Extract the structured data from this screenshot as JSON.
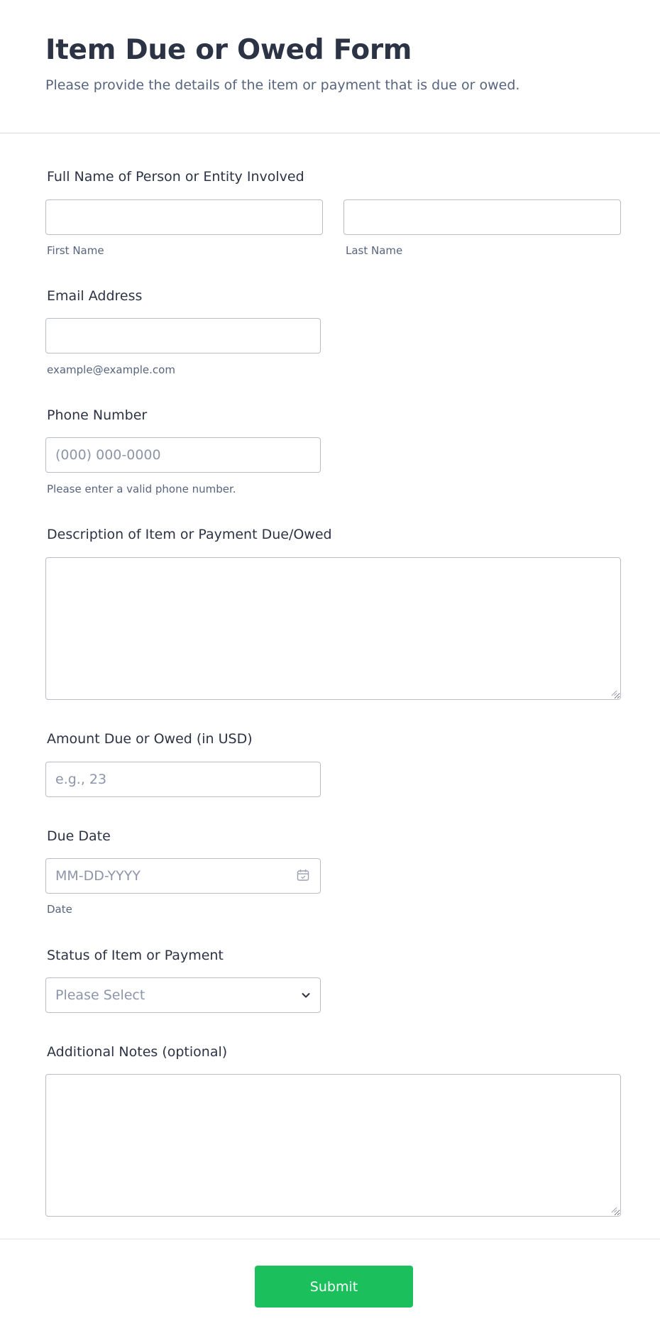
{
  "header": {
    "title": "Item Due or Owed Form",
    "subtitle": "Please provide the details of the item or payment that is due or owed."
  },
  "fields": {
    "full_name": {
      "label": "Full Name of Person or Entity Involved",
      "first_sublabel": "First Name",
      "last_sublabel": "Last Name",
      "first_value": "",
      "last_value": ""
    },
    "email": {
      "label": "Email Address",
      "sublabel": "example@example.com",
      "value": ""
    },
    "phone": {
      "label": "Phone Number",
      "placeholder": "(000) 000-0000",
      "sublabel": "Please enter a valid phone number.",
      "value": ""
    },
    "description": {
      "label": "Description of Item or Payment Due/Owed",
      "value": ""
    },
    "amount": {
      "label": "Amount Due or Owed (in USD)",
      "placeholder": "e.g., 23",
      "value": ""
    },
    "due_date": {
      "label": "Due Date",
      "placeholder": "MM-DD-YYYY",
      "sublabel": "Date",
      "icon": "calendar-icon",
      "value": ""
    },
    "status": {
      "label": "Status of Item or Payment",
      "selected": "Please Select",
      "icon": "chevron-down-icon"
    },
    "notes": {
      "label": "Additional Notes (optional)",
      "value": ""
    }
  },
  "footer": {
    "submit_label": "Submit"
  },
  "colors": {
    "title": "#2c3345",
    "subtext": "#57647e",
    "input_border": "#b8bdc9",
    "placeholder": "#8d96a8",
    "submit_bg": "#1bbf5c",
    "submit_text": "#ffffff"
  }
}
